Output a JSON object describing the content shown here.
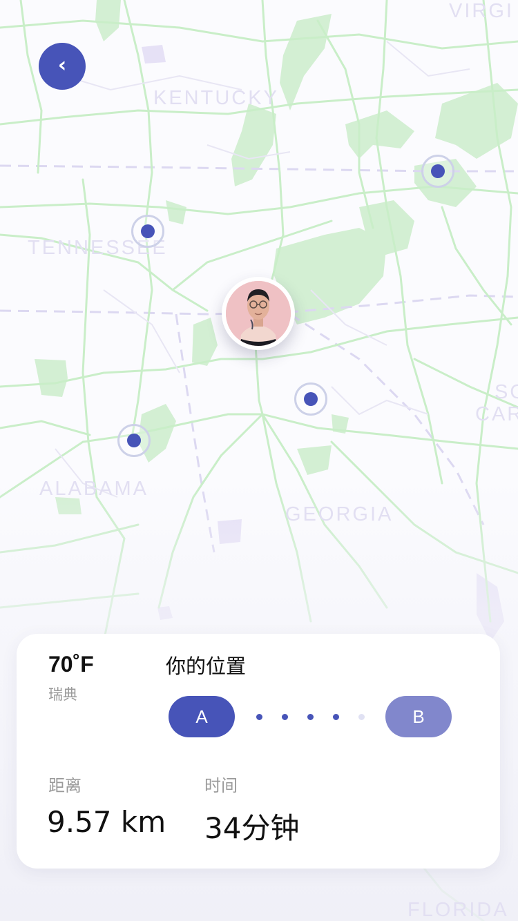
{
  "header": {
    "back_button_glyph": "‹",
    "back_icon": "chevron-left-icon"
  },
  "map": {
    "labels": {
      "kentucky": "KENTUCKY",
      "tennessee": "TENNESSEE",
      "alabama": "ALABAMA",
      "georgia": "GEORGIA",
      "virginia": "VIRGI",
      "south_carolina_1": "SO",
      "south_carolina_2": "CAR",
      "florida": "FLORIDA"
    },
    "road_color": "#c9eec8",
    "forest_color": "#cfeed0",
    "border_color": "#d7d3ee",
    "marker_count": 4,
    "user_avatar": "user-avatar"
  },
  "info_card": {
    "temperature": "70˚F",
    "place": "瑞典",
    "location_title": "你的位置",
    "point_a": "A",
    "point_b": "B",
    "distance_label": "距离",
    "distance_value": "9.57 km",
    "time_label": "时间",
    "time_value": "34分钟"
  },
  "colors": {
    "accent": "#4754b8",
    "accent_light": "#8187cc",
    "muted_text": "#9a9a9a"
  }
}
